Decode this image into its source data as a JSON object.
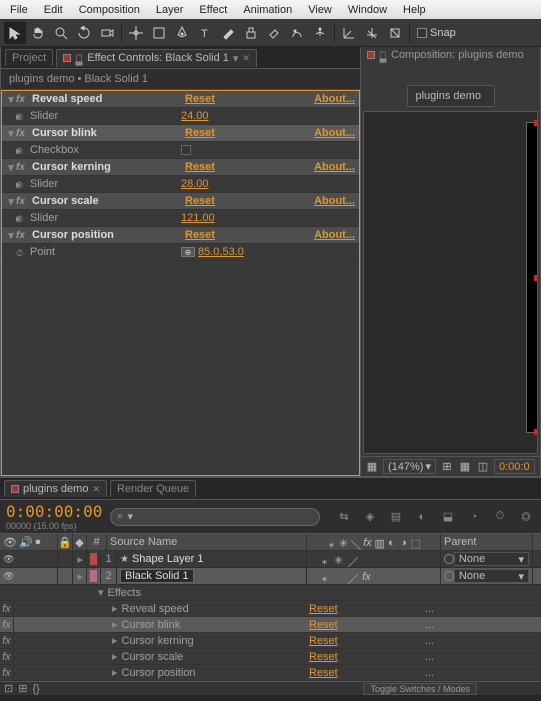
{
  "menu": [
    "File",
    "Edit",
    "Composition",
    "Layer",
    "Effect",
    "Animation",
    "View",
    "Window",
    "Help"
  ],
  "toolbar": {
    "snap_label": "Snap"
  },
  "left_tabs": {
    "project": "Project",
    "effect_controls": "Effect Controls: Black Solid 1"
  },
  "breadcrumb": "plugins demo • Black Solid 1",
  "reset_label": "Reset",
  "about_label": "About...",
  "effects": [
    {
      "name": "Reveal speed",
      "sub": {
        "type": "slider",
        "label": "Slider",
        "value": "24.00"
      }
    },
    {
      "name": "Cursor blink",
      "selected": true,
      "sub": {
        "type": "checkbox",
        "label": "Checkbox"
      }
    },
    {
      "name": "Cursor kerning",
      "sub": {
        "type": "slider",
        "label": "Slider",
        "value": "28.00"
      }
    },
    {
      "name": "Cursor scale",
      "sub": {
        "type": "slider",
        "label": "Slider",
        "value": "121.00"
      }
    },
    {
      "name": "Cursor position",
      "sub": {
        "type": "point",
        "label": "Point",
        "value": "85.0,53.0"
      }
    }
  ],
  "comp_tab": "Composition: plugins demo",
  "comp_subtab": "plugins demo",
  "comp_zoom": "(147%)",
  "comp_time": "0:00:0",
  "timeline": {
    "tabs": [
      "plugins demo",
      "Render Queue"
    ],
    "time": "0:00:00:00",
    "subtime": "00000 (15.00 fps)",
    "search_placeholder": "",
    "col_num": "#",
    "col_source": "Source Name",
    "col_parent": "Parent",
    "layers": [
      {
        "num": "1",
        "name": "Shape Layer 1",
        "label": "red",
        "parent": "None",
        "shape": true
      },
      {
        "num": "2",
        "name": "Black Solid 1",
        "label": "pink",
        "parent": "None",
        "selected": true
      }
    ],
    "effects_header": "Effects",
    "layer_effects": [
      {
        "name": "Reveal speed",
        "reset": "Reset",
        "dots": "..."
      },
      {
        "name": "Cursor blink",
        "reset": "Reset",
        "dots": "...",
        "selected": true
      },
      {
        "name": "Cursor kerning",
        "reset": "Reset",
        "dots": "..."
      },
      {
        "name": "Cursor scale",
        "reset": "Reset",
        "dots": "..."
      },
      {
        "name": "Cursor position",
        "reset": "Reset",
        "dots": "..."
      }
    ],
    "toggle_label": "Toggle Switches / Modes"
  }
}
